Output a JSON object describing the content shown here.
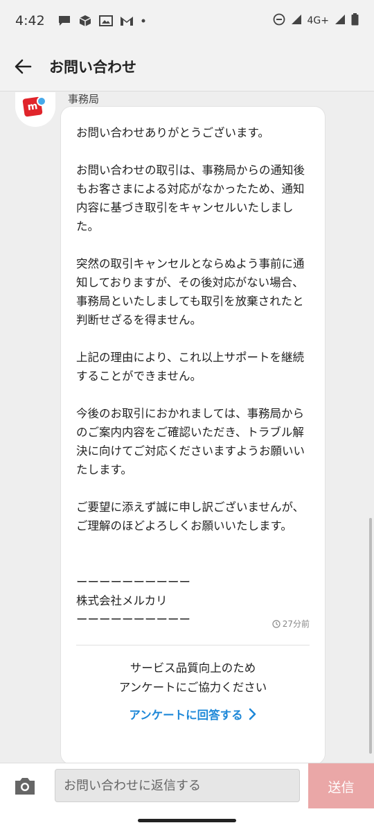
{
  "status_bar": {
    "time": "4:42",
    "network": "4G+"
  },
  "header": {
    "title": "お問い合わせ"
  },
  "message": {
    "sender": "事務局",
    "body": "お問い合わせありがとうございます。\n\nお問い合わせの取引は、事務局からの通知後もお客さまによる対応がなかったため、通知内容に基づき取引をキャンセルいたしました。\n\n突然の取引キャンセルとならぬよう事前に通知しておりますが、その後対応がない場合、事務局といたしましても取引を放棄されたと判断せざるを得ません。\n\n上記の理由により、これ以上サポートを継続することができません。\n\n今後のお取引におかれましては、事務局からのご案内内容をご確認いただき、トラブル解決に向けてご対応くださいますようお願いいたします。\n\nご要望に添えず誠に申し訳ございませんが、ご理解のほどよろしくお願いいたします。\n\n\nーーーーーーーーーー\n株式会社メルカリ\nーーーーーーーーーー",
    "timestamp": "27分前"
  },
  "survey": {
    "line1": "サービス品質向上のため",
    "line2": "アンケートにご協力ください",
    "link_label": "アンケートに回答する"
  },
  "composer": {
    "placeholder": "お問い合わせに返信する",
    "send_label": "送信"
  },
  "colors": {
    "accent_link": "#1e88d8",
    "send_button": "#eaa7a7",
    "brand_red": "#e0242b",
    "badge_blue": "#46a9ea"
  }
}
